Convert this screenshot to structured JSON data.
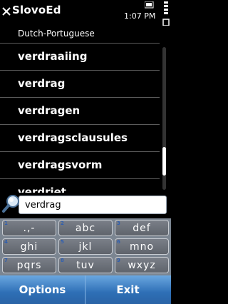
{
  "status": {
    "app_title": "SlovoEd",
    "time": "1:07 PM"
  },
  "dictionary": {
    "name": "Dutch-Portuguese"
  },
  "words": [
    {
      "label": "verdraaiing"
    },
    {
      "label": "verdrag"
    },
    {
      "label": "verdragen"
    },
    {
      "label": "verdragsclausules"
    },
    {
      "label": "verdragsvorm"
    },
    {
      "label": "verdriet"
    }
  ],
  "search": {
    "value": "verdrag"
  },
  "keypad": {
    "keys": [
      {
        "num": "1",
        "letters": ".,-"
      },
      {
        "num": "2",
        "letters": "abc"
      },
      {
        "num": "3",
        "letters": "def"
      },
      {
        "num": "4",
        "letters": "ghi"
      },
      {
        "num": "5",
        "letters": "jkl"
      },
      {
        "num": "6",
        "letters": "mno"
      },
      {
        "num": "7",
        "letters": "pqrs"
      },
      {
        "num": "8",
        "letters": "tuv"
      },
      {
        "num": "9",
        "letters": "wxyz"
      }
    ]
  },
  "softkeys": {
    "left": "Options",
    "right": "Exit"
  },
  "colors": {
    "softkey_bar": "#2e6fb6",
    "keypad_bg": "#7b8591",
    "background": "#000000"
  }
}
